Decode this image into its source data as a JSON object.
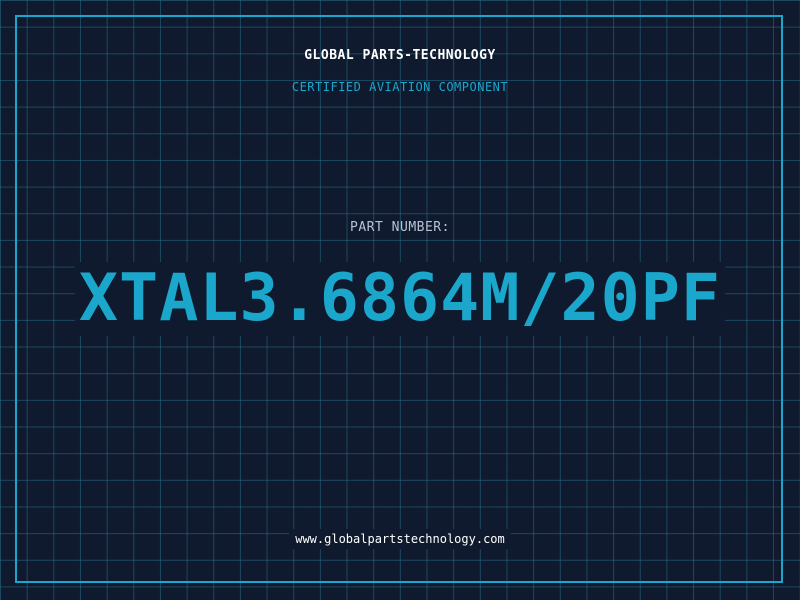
{
  "header": {
    "brand": "GLOBAL PARTS-TECHNOLOGY",
    "certification": "CERTIFIED AVIATION COMPONENT"
  },
  "part": {
    "label": "PART NUMBER:",
    "number": "XTAL3.6864M/20PF"
  },
  "footer": {
    "website": "www.globalpartstechnology.com"
  },
  "colors": {
    "background": "#0f1a2e",
    "accent": "#1ba6cc",
    "grid": "#286e8c",
    "text": "#ffffff"
  }
}
